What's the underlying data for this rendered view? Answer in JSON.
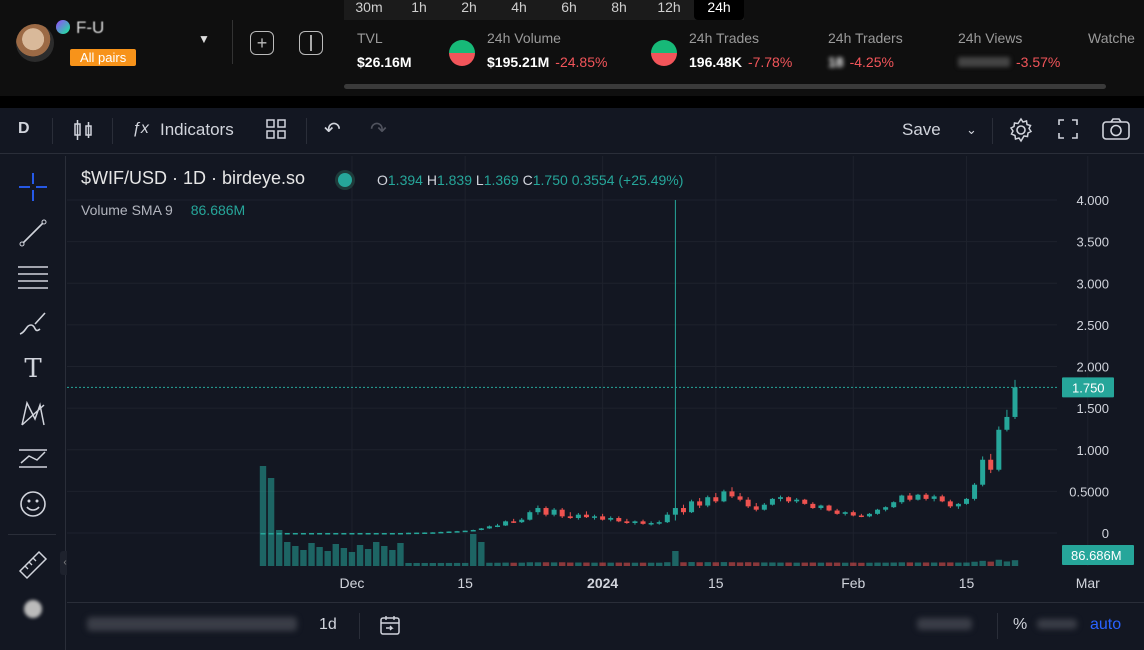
{
  "header": {
    "pair_name": "F-U",
    "all_pairs": "All pairs",
    "timeframes": [
      {
        "label": "30m",
        "active": false
      },
      {
        "label": "1h",
        "active": false
      },
      {
        "label": "2h",
        "active": false
      },
      {
        "label": "4h",
        "active": false
      },
      {
        "label": "6h",
        "active": false
      },
      {
        "label": "8h",
        "active": false
      },
      {
        "label": "12h",
        "active": false
      },
      {
        "label": "24h",
        "active": true
      }
    ],
    "stats": {
      "tvl": {
        "label": "TVL",
        "value": "$26.16M"
      },
      "volume": {
        "label": "24h Volume",
        "value": "$195.21M",
        "change": "-24.85%"
      },
      "trades": {
        "label": "24h Trades",
        "value": "196.48K",
        "change": "-7.78%"
      },
      "traders": {
        "label": "24h Traders",
        "value": "18",
        "change": "-4.25%"
      },
      "views": {
        "label": "24h Views",
        "value": "",
        "change": "-3.57%"
      },
      "watchers": {
        "label": "Watche"
      }
    }
  },
  "toolbar": {
    "interval": "D",
    "indicators": "Indicators",
    "save": "Save"
  },
  "legend": {
    "title": "$WIF/USD · 1D · birdeye.so",
    "o_label": "O",
    "o": "1.394",
    "h_label": "H",
    "h": "1.839",
    "l_label": "L",
    "l": "1.369",
    "c_label": "C",
    "c": "1.750",
    "change": "0.3554 (+25.49%)",
    "volume_label": "Volume",
    "sma_label": "SMA 9",
    "volume_value": "86.686M"
  },
  "bottom": {
    "interval": "1d",
    "percent": "%",
    "auto": "auto"
  },
  "colors": {
    "up": "#26a69a",
    "down": "#ef5350",
    "price_line": "#26a69a",
    "accent": "#2962ff"
  },
  "chart_data": {
    "type": "candlestick",
    "title": "$WIF/USD · 1D · birdeye.so",
    "y_ticks": [
      "4.000",
      "3.500",
      "3.000",
      "2.500",
      "2.000",
      "1.500",
      "1.000",
      "0.5000",
      "0"
    ],
    "ylim": [
      0,
      4.0
    ],
    "x_ticks": [
      "Dec",
      "15",
      "2024",
      "15",
      "Feb",
      "15",
      "Mar"
    ],
    "last_price": "1.750",
    "last_volume_label": "86.686M",
    "grid": true,
    "first_date": "2023-11-20",
    "candles": [
      [
        0.0001,
        0.0001,
        0.0001,
        0.0001
      ],
      [
        0.0001,
        0.0001,
        0.0001,
        0.0001
      ],
      [
        0.0001,
        0.0001,
        0.0001,
        0.0001
      ],
      [
        0.0001,
        0.0001,
        0.0001,
        0.0001
      ],
      [
        0.0001,
        0.0001,
        0.0001,
        0.0001
      ],
      [
        0.0001,
        0.0001,
        0.0001,
        0.0001
      ],
      [
        0.0001,
        0.0001,
        0.0001,
        0.0001
      ],
      [
        0.0001,
        0.0001,
        0.0001,
        0.0001
      ],
      [
        0.0001,
        0.0001,
        0.0001,
        0.0001
      ],
      [
        0.0001,
        0.0001,
        0.0001,
        0.0001
      ],
      [
        0.0001,
        0.0001,
        0.0001,
        0.0001
      ],
      [
        0.0001,
        0.0001,
        0.0001,
        0.0001
      ],
      [
        0.0001,
        0.0001,
        0.0001,
        0.0001
      ],
      [
        0.0001,
        0.0001,
        0.0001,
        0.0001
      ],
      [
        0.0001,
        0.0001,
        0.0001,
        0.0001
      ],
      [
        0.0001,
        0.0001,
        0.0001,
        0.0001
      ],
      [
        0.0001,
        0.0001,
        0.0001,
        0.0001
      ],
      [
        0.0001,
        0.0001,
        0.0001,
        0.0001
      ],
      [
        0.002,
        0.004,
        0.001,
        0.003
      ],
      [
        0.003,
        0.006,
        0.002,
        0.005
      ],
      [
        0.005,
        0.008,
        0.004,
        0.006
      ],
      [
        0.006,
        0.009,
        0.005,
        0.008
      ],
      [
        0.008,
        0.015,
        0.007,
        0.013
      ],
      [
        0.013,
        0.02,
        0.011,
        0.018
      ],
      [
        0.018,
        0.025,
        0.015,
        0.022
      ],
      [
        0.022,
        0.03,
        0.019,
        0.028
      ],
      [
        0.028,
        0.04,
        0.025,
        0.036
      ],
      [
        0.036,
        0.06,
        0.033,
        0.055
      ],
      [
        0.055,
        0.09,
        0.05,
        0.08
      ],
      [
        0.08,
        0.11,
        0.07,
        0.09
      ],
      [
        0.09,
        0.15,
        0.085,
        0.14
      ],
      [
        0.14,
        0.17,
        0.12,
        0.13
      ],
      [
        0.13,
        0.18,
        0.12,
        0.16
      ],
      [
        0.16,
        0.27,
        0.15,
        0.25
      ],
      [
        0.25,
        0.33,
        0.22,
        0.3
      ],
      [
        0.3,
        0.32,
        0.2,
        0.22
      ],
      [
        0.22,
        0.3,
        0.2,
        0.28
      ],
      [
        0.28,
        0.3,
        0.18,
        0.2
      ],
      [
        0.2,
        0.25,
        0.17,
        0.18
      ],
      [
        0.18,
        0.24,
        0.16,
        0.22
      ],
      [
        0.22,
        0.26,
        0.18,
        0.19
      ],
      [
        0.19,
        0.22,
        0.16,
        0.2
      ],
      [
        0.2,
        0.23,
        0.15,
        0.16
      ],
      [
        0.16,
        0.2,
        0.14,
        0.18
      ],
      [
        0.18,
        0.2,
        0.13,
        0.14
      ],
      [
        0.14,
        0.17,
        0.11,
        0.12
      ],
      [
        0.12,
        0.15,
        0.1,
        0.14
      ],
      [
        0.14,
        0.16,
        0.1,
        0.11
      ],
      [
        0.11,
        0.14,
        0.09,
        0.12
      ],
      [
        0.12,
        0.15,
        0.1,
        0.13
      ],
      [
        0.13,
        0.25,
        0.12,
        0.22
      ],
      [
        0.22,
        4.0,
        0.15,
        0.3
      ],
      [
        0.3,
        0.34,
        0.22,
        0.25
      ],
      [
        0.25,
        0.4,
        0.24,
        0.38
      ],
      [
        0.38,
        0.42,
        0.3,
        0.33
      ],
      [
        0.33,
        0.45,
        0.31,
        0.43
      ],
      [
        0.43,
        0.48,
        0.36,
        0.38
      ],
      [
        0.38,
        0.52,
        0.37,
        0.5
      ],
      [
        0.5,
        0.55,
        0.42,
        0.44
      ],
      [
        0.44,
        0.48,
        0.38,
        0.4
      ],
      [
        0.4,
        0.43,
        0.3,
        0.32
      ],
      [
        0.32,
        0.36,
        0.26,
        0.28
      ],
      [
        0.28,
        0.36,
        0.27,
        0.34
      ],
      [
        0.34,
        0.42,
        0.33,
        0.41
      ],
      [
        0.41,
        0.45,
        0.38,
        0.43
      ],
      [
        0.43,
        0.44,
        0.36,
        0.38
      ],
      [
        0.38,
        0.42,
        0.36,
        0.4
      ],
      [
        0.4,
        0.41,
        0.34,
        0.35
      ],
      [
        0.35,
        0.37,
        0.29,
        0.3
      ],
      [
        0.3,
        0.34,
        0.28,
        0.33
      ],
      [
        0.33,
        0.34,
        0.26,
        0.27
      ],
      [
        0.27,
        0.29,
        0.22,
        0.23
      ],
      [
        0.23,
        0.26,
        0.21,
        0.25
      ],
      [
        0.25,
        0.27,
        0.2,
        0.21
      ],
      [
        0.21,
        0.23,
        0.19,
        0.2
      ],
      [
        0.2,
        0.24,
        0.19,
        0.23
      ],
      [
        0.23,
        0.29,
        0.22,
        0.28
      ],
      [
        0.28,
        0.32,
        0.26,
        0.31
      ],
      [
        0.31,
        0.38,
        0.3,
        0.37
      ],
      [
        0.37,
        0.46,
        0.35,
        0.45
      ],
      [
        0.45,
        0.48,
        0.38,
        0.4
      ],
      [
        0.4,
        0.47,
        0.39,
        0.46
      ],
      [
        0.46,
        0.48,
        0.39,
        0.41
      ],
      [
        0.41,
        0.46,
        0.38,
        0.44
      ],
      [
        0.44,
        0.46,
        0.37,
        0.38
      ],
      [
        0.38,
        0.4,
        0.3,
        0.32
      ],
      [
        0.32,
        0.36,
        0.29,
        0.35
      ],
      [
        0.35,
        0.42,
        0.34,
        0.41
      ],
      [
        0.41,
        0.6,
        0.39,
        0.58
      ],
      [
        0.58,
        0.92,
        0.56,
        0.88
      ],
      [
        0.88,
        0.95,
        0.72,
        0.76
      ],
      [
        0.76,
        1.28,
        0.74,
        1.24
      ],
      [
        1.24,
        1.48,
        1.22,
        1.394
      ],
      [
        1.394,
        1.839,
        1.369,
        1.75
      ]
    ]
  }
}
